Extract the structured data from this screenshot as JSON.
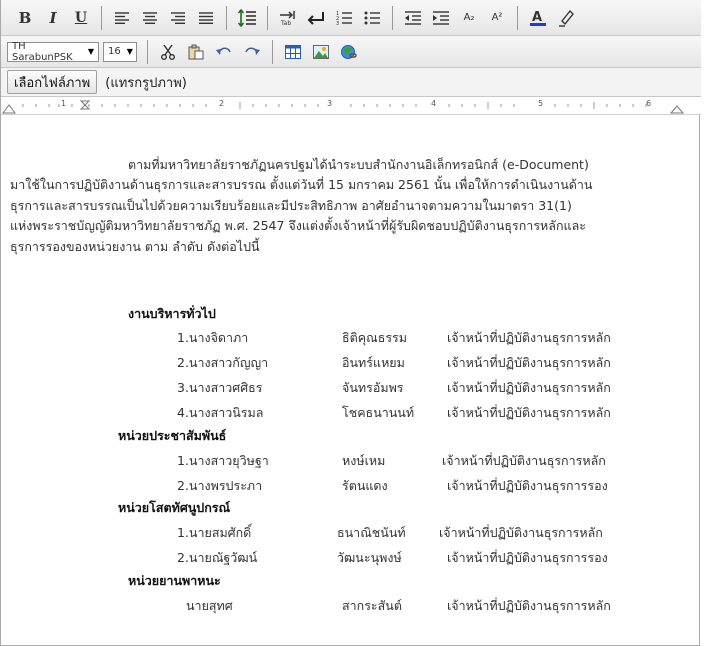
{
  "toolbar": {
    "row1": {
      "bold": "B",
      "italic": "I",
      "underline": "U",
      "subscript": "A₂",
      "superscript": "A²"
    },
    "font_name": "TH SarabunPSK",
    "font_size": "16",
    "file_button": "เลือกไฟล์ภาพ",
    "file_note": "(แทรกรูปภาพ)"
  },
  "ruler": {
    "marks": [
      "1",
      "2",
      "3",
      "4",
      "5",
      "6"
    ]
  },
  "document": {
    "intro_lines": [
      "ตามที่มหาวิทยาลัยราชภัฏนครปฐมได้นำระบบสำนักงานอิเล็กทรอนิกส์ (e-Document)",
      "มาใช้ในการปฏิบัติงานด้านธุรการและสารบรรณ ตั้งแต่วันที่ 15 มกราคม 2561 นั้น เพื่อให้การดำเนินงานด้าน",
      "ธุรการและสารบรรณเป็นไปด้วยความเรียบร้อยและมีประสิทธิภาพ อาศัยอำนาจตามความในมาตรา 31(1)",
      "แห่งพระราชบัญญัติมหาวิทยาลัยราชภัฏ พ.ศ. 2547 จึงแต่งตั้งเจ้าหน้าที่ผู้รับผิดชอบปฏิบัติงานธุรการหลักและ",
      "ธุรการรองของหน่วยงาน ตาม ลำดับ ดังต่อไปนี้"
    ],
    "sections": [
      {
        "title": "งานบริหารทั่วไป",
        "people": [
          {
            "name": "1.นางจิดาภา",
            "surname": "ธิติคุณธรรม",
            "role": "เจ้าหน้าที่ปฏิบัติงานธุรการหลัก"
          },
          {
            "name": "2.นางสาวกัญญา",
            "surname": "อินทร์แหยม",
            "role": "เจ้าหน้าที่ปฏิบัติงานธุรการหลัก"
          },
          {
            "name": "3.นางสาวศศิธร",
            "surname": "จันทรอัมพร",
            "role": "เจ้าหน้าที่ปฏิบัติงานธุรการหลัก"
          },
          {
            "name": "4.นางสาวนิรมล",
            "surname": "โชคธนานนท์",
            "role": "เจ้าหน้าที่ปฏิบัติงานธุรการหลัก"
          }
        ]
      },
      {
        "title": "หน่วยประชาสัมพันธ์",
        "people": [
          {
            "name": "1.นางสาวยุวิษฐา",
            "surname": "หงษ์เหม",
            "role": "เจ้าหน้าที่ปฏิบัติงานธุรการหลัก"
          },
          {
            "name": "2.นางพรประภา",
            "surname": "รัตนแดง",
            "role": "เจ้าหน้าที่ปฏิบัติงานธุรการรอง"
          }
        ]
      },
      {
        "title": "หน่วยโสตทัศนูปกรณ์",
        "people": [
          {
            "name": "1.นายสมศักดิ์",
            "surname": "ธนาณิชนันท์",
            "role": "เจ้าหน้าที่ปฏิบัติงานธุรการหลัก"
          },
          {
            "name": "2.นายณัฐวัฒน์",
            "surname": "วัฒนะนุพงษ์",
            "role": "เจ้าหน้าที่ปฏิบัติงานธุรการรอง"
          }
        ]
      },
      {
        "title": "หน่วยยานพาหนะ",
        "people": [
          {
            "name": "นายสุทศ",
            "surname": "สากระสันต์",
            "role": "เจ้าหน้าที่ปฏิบัติงานธุรการหลัก"
          }
        ]
      }
    ]
  }
}
